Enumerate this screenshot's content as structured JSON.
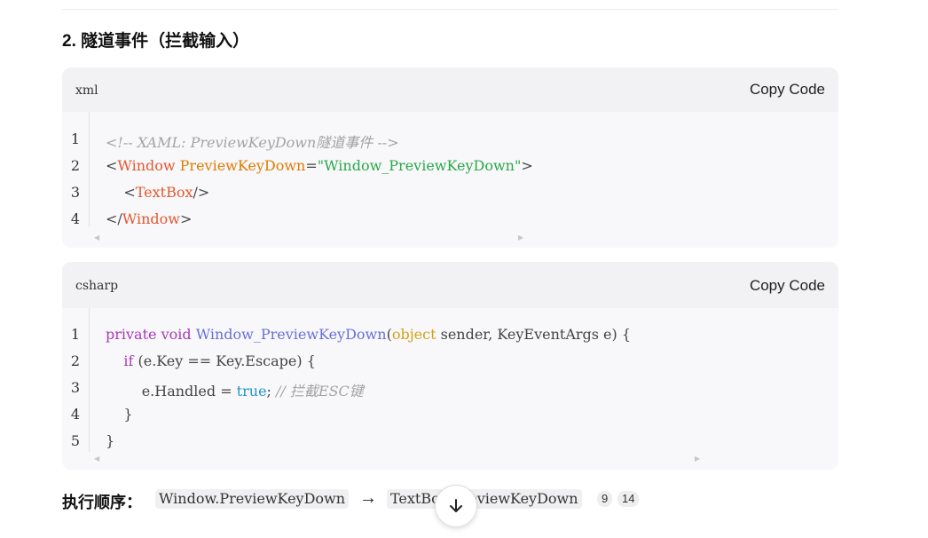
{
  "heading": "2. 隧道事件（拦截输入）",
  "xml_block": {
    "language": "xml",
    "copy_label": "Copy Code",
    "line_numbers": [
      "1",
      "2",
      "3",
      "4"
    ],
    "lines": [
      [
        {
          "t": "<!-- XAML: PreviewKeyDown隧道事件 -->",
          "c": "c-comment"
        }
      ],
      [
        {
          "t": "<",
          "c": "c-plain"
        },
        {
          "t": "Window",
          "c": "c-tag"
        },
        {
          "t": " ",
          "c": "c-plain"
        },
        {
          "t": "PreviewKeyDown",
          "c": "c-attr"
        },
        {
          "t": "=",
          "c": "c-plain"
        },
        {
          "t": "\"Window_PreviewKeyDown\"",
          "c": "c-str"
        },
        {
          "t": ">",
          "c": "c-plain"
        }
      ],
      [
        {
          "t": "    <",
          "c": "c-plain"
        },
        {
          "t": "TextBox",
          "c": "c-tag"
        },
        {
          "t": "/>",
          "c": "c-plain"
        }
      ],
      [
        {
          "t": "</",
          "c": "c-plain"
        },
        {
          "t": "Window",
          "c": "c-tag"
        },
        {
          "t": ">",
          "c": "c-plain"
        }
      ]
    ]
  },
  "csharp_block": {
    "language": "csharp",
    "copy_label": "Copy Code",
    "line_numbers": [
      "1",
      "2",
      "3",
      "4",
      "5"
    ],
    "lines": [
      [
        {
          "t": "private",
          "c": "c-kw"
        },
        {
          "t": " ",
          "c": "c-plain"
        },
        {
          "t": "void",
          "c": "c-kw"
        },
        {
          "t": " ",
          "c": "c-plain"
        },
        {
          "t": "Window_PreviewKeyDown",
          "c": "c-fn"
        },
        {
          "t": "(",
          "c": "c-plain"
        },
        {
          "t": "object",
          "c": "c-type"
        },
        {
          "t": " sender, KeyEventArgs e) {",
          "c": "c-plain"
        }
      ],
      [
        {
          "t": "    ",
          "c": "c-plain"
        },
        {
          "t": "if",
          "c": "c-kw"
        },
        {
          "t": " (e.Key == Key.Escape) {",
          "c": "c-plain"
        }
      ],
      [
        {
          "t": "        e.Handled = ",
          "c": "c-plain"
        },
        {
          "t": "true",
          "c": "c-lit"
        },
        {
          "t": "; ",
          "c": "c-plain"
        },
        {
          "t": "// 拦截ESC键",
          "c": "c-comment"
        }
      ],
      [
        {
          "t": "    }",
          "c": "c-plain"
        }
      ],
      [
        {
          "t": "}",
          "c": "c-plain"
        }
      ]
    ]
  },
  "order": {
    "label": "执行顺序：",
    "chip1": "Window.PreviewKeyDown",
    "arrow": "→",
    "chip2": "TextBox.PreviewKeyDown",
    "ref1": "9",
    "ref2": "14"
  },
  "scroll_button": {
    "icon": "arrow-down-icon"
  }
}
